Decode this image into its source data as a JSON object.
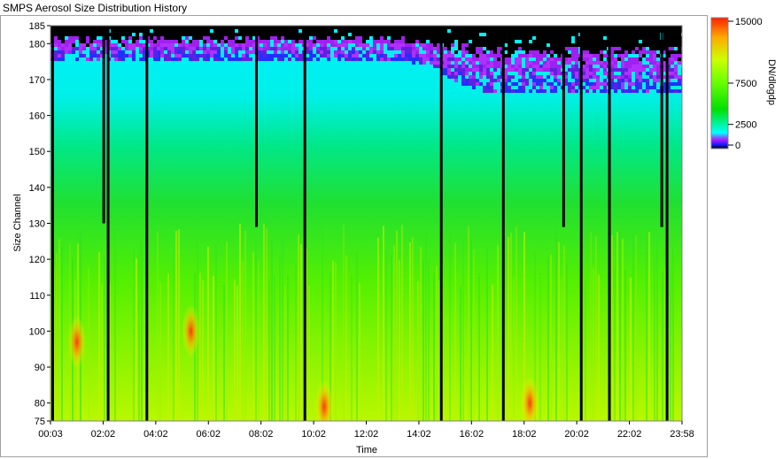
{
  "window": {
    "title": "SMPS Aerosol Size Distribution History"
  },
  "chart_data": {
    "type": "heatmap",
    "title": "SMPS Aerosol Size Distribution History",
    "xlabel": "Time",
    "ylabel": "Size Channel",
    "colorbar_label": "DN/dlogdp",
    "x_tick_labels": [
      "00:03",
      "02:02",
      "04:02",
      "06:02",
      "08:02",
      "10:02",
      "12:02",
      "14:02",
      "16:02",
      "18:02",
      "20:02",
      "22:02",
      "23:58"
    ],
    "x_range_minutes": [
      3,
      1438
    ],
    "y_ticks": [
      75,
      80,
      90,
      100,
      110,
      120,
      130,
      140,
      150,
      160,
      170,
      180,
      185
    ],
    "y_range": [
      75,
      185
    ],
    "colorbar_ticks": [
      0,
      2500,
      7500,
      15000
    ],
    "colorbar_tick_labels": [
      "0",
      "2500",
      "7500",
      "15000"
    ],
    "colorbar_range": [
      0,
      15000
    ],
    "colorscale": [
      "#000000",
      "#1a1aff",
      "#b020ff",
      "#00ffff",
      "#00e000",
      "#66ff00",
      "#ccff00",
      "#ffaa00",
      "#ff2000"
    ],
    "gap_lines": [
      {
        "time_min": 8,
        "from_channel": 75,
        "to_channel": 185
      },
      {
        "time_min": 124,
        "from_channel": 130,
        "to_channel": 185
      },
      {
        "time_min": 134,
        "from_channel": 75,
        "to_channel": 185
      },
      {
        "time_min": 222,
        "from_channel": 75,
        "to_channel": 185
      },
      {
        "time_min": 471,
        "from_channel": 129,
        "to_channel": 185
      },
      {
        "time_min": 581,
        "from_channel": 75,
        "to_channel": 185
      },
      {
        "time_min": 891,
        "from_channel": 75,
        "to_channel": 185
      },
      {
        "time_min": 1032,
        "from_channel": 75,
        "to_channel": 185
      },
      {
        "time_min": 1169,
        "from_channel": 129,
        "to_channel": 185
      },
      {
        "time_min": 1209,
        "from_channel": 75,
        "to_channel": 185
      },
      {
        "time_min": 1273,
        "from_channel": 75,
        "to_channel": 185
      },
      {
        "time_min": 1392,
        "from_channel": 129,
        "to_channel": 185
      },
      {
        "time_min": 1404,
        "from_channel": 75,
        "to_channel": 185
      }
    ],
    "hotspots": [
      {
        "time_min": 63,
        "channel": 97
      },
      {
        "time_min": 322,
        "channel": 100
      },
      {
        "time_min": 625,
        "channel": 79
      },
      {
        "time_min": 1092,
        "channel": 80
      }
    ]
  }
}
